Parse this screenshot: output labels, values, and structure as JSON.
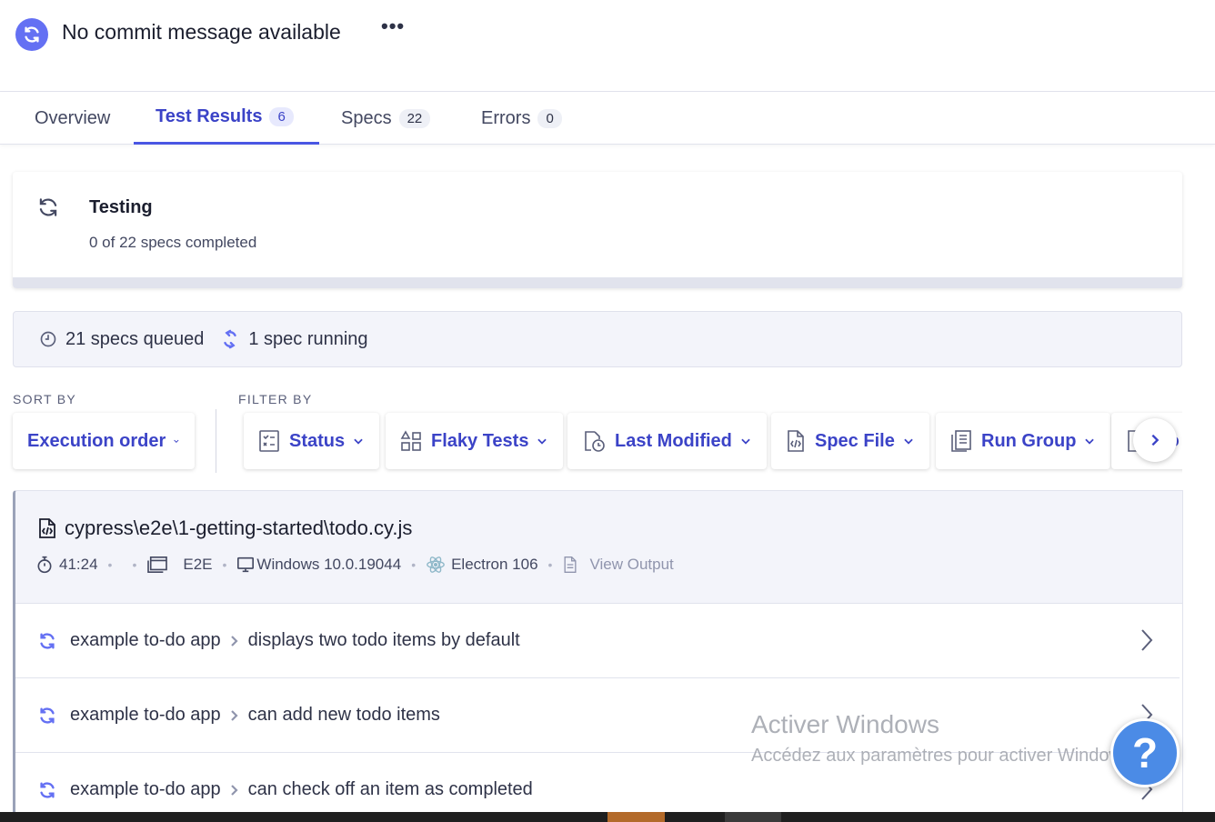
{
  "header": {
    "commit_title": "No commit message available",
    "more_label": "•••"
  },
  "tabs": [
    {
      "label": "Overview",
      "count": ""
    },
    {
      "label": "Test Results",
      "count": "6"
    },
    {
      "label": "Specs",
      "count": "22"
    },
    {
      "label": "Errors",
      "count": "0"
    }
  ],
  "testing": {
    "title": "Testing",
    "subtitle": "0 of 22 specs completed",
    "progress": 0
  },
  "queue": {
    "queued": "21 specs queued",
    "running": "1 spec running"
  },
  "sort": {
    "label": "SORT BY",
    "value": "Execution order"
  },
  "filter": {
    "label": "FILTER BY",
    "items": [
      "Status",
      "Flaky Tests",
      "Last Modified",
      "Spec File",
      "Run Group",
      "Co"
    ]
  },
  "spec": {
    "path": "cypress\\e2e\\1-getting-started\\todo.cy.js",
    "duration": "41:24",
    "testing_type": "E2E",
    "os": "Windows 10.0.19044",
    "browser": "Electron 106",
    "view_output": "View Output"
  },
  "tests": [
    {
      "suite": "example to-do app",
      "title": "displays two todo items by default"
    },
    {
      "suite": "example to-do app",
      "title": "can add new todo items"
    },
    {
      "suite": "example to-do app",
      "title": "can check off an item as completed"
    }
  ],
  "watermark": {
    "line1": "Activer Windows",
    "line2": "Accédez aux paramètres pour activer Windows."
  },
  "help": {
    "label": "?"
  },
  "colors": {
    "accent": "#3b43c7",
    "running": "#6470f3",
    "help": "#4b8be6"
  }
}
